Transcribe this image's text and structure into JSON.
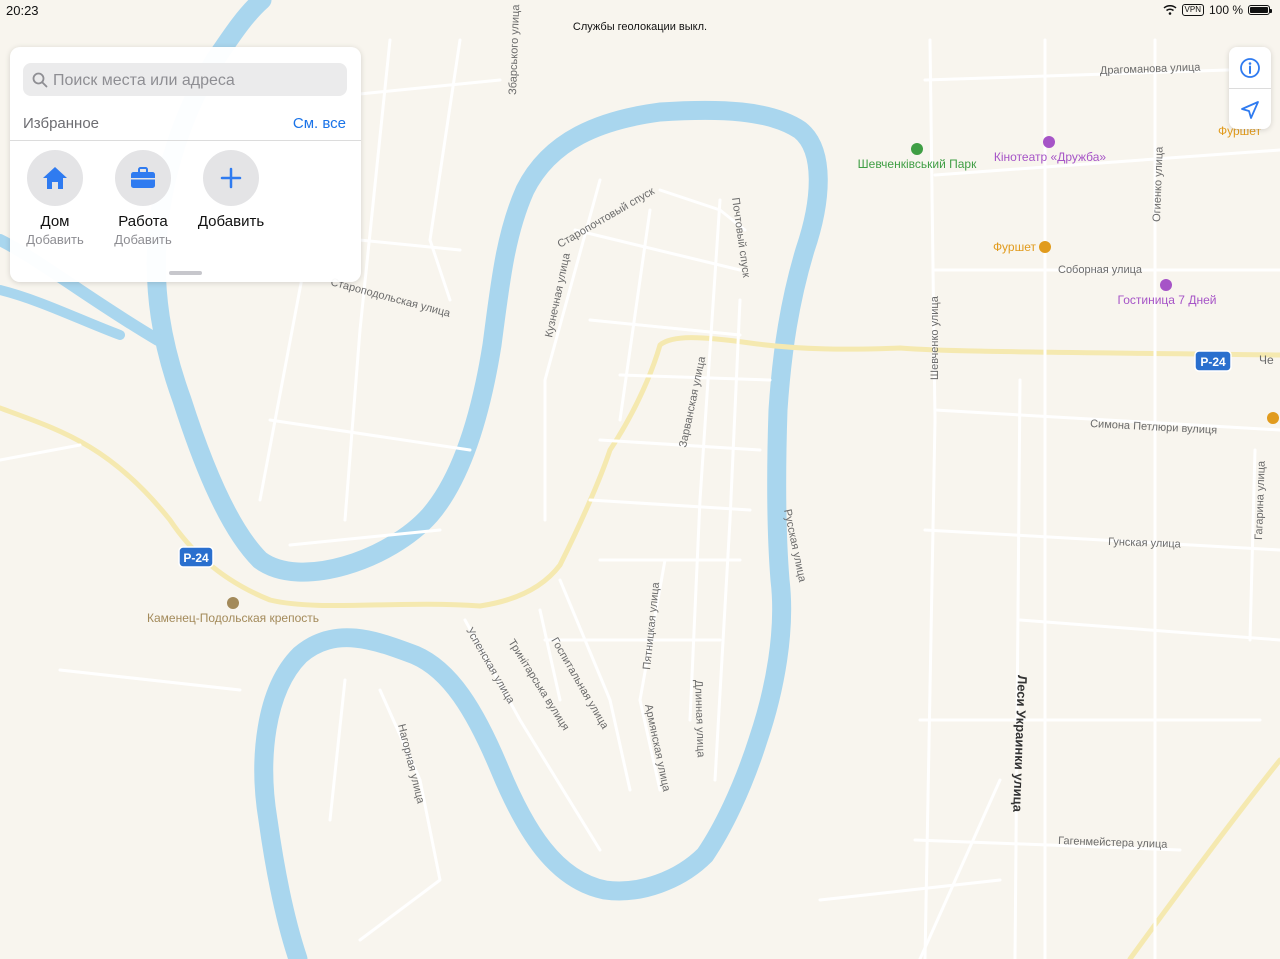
{
  "status": {
    "time": "20:23",
    "location_notice": "Службы геолокации выкл.",
    "vpn": "VPN",
    "battery": "100 %",
    "battery_level": 1.0
  },
  "search": {
    "placeholder": "Поиск места или адреса"
  },
  "favorites": {
    "title": "Избранное",
    "see_all": "См. все",
    "items": [
      {
        "name": "Дом",
        "sub": "Добавить",
        "icon": "home-icon"
      },
      {
        "name": "Работа",
        "sub": "Добавить",
        "icon": "briefcase-icon"
      },
      {
        "name": "Добавить",
        "sub": "",
        "icon": "plus-icon"
      }
    ]
  },
  "map_controls": [
    {
      "name": "info-button",
      "icon": "info-icon"
    },
    {
      "name": "locate-button",
      "icon": "location-arrow-icon"
    }
  ],
  "map": {
    "colors": {
      "land": "#f8f5ee",
      "water": "#a9d6ee",
      "road": "#ffffff",
      "road_casing": "#dcd8d0",
      "major_road": "#f5e9b0",
      "label": "#6b6b6b",
      "poi_green": "#3f9e44",
      "poi_purple": "#a654c7",
      "poi_orange": "#e19b1d",
      "shield_blue": "#2a6fce"
    },
    "street_labels": [
      "Збарського улица",
      "Драгоманова улица",
      "Староподольская улица",
      "Старопочтовый спуск",
      "Почтовый спуск",
      "Кузнечная улица",
      "Зарванская улица",
      "Огиенко улица",
      "Соборная улица",
      "Шевченко улица",
      "Симона Петлюри вулиця",
      "Гагарина улица",
      "Гунская улица",
      "Русская улица",
      "Успенская улица",
      "Тринітарська вулиця",
      "Госпитальная улица",
      "Пятницкая улица",
      "Армянская улица",
      "Длинная улица",
      "Нагорная улица",
      "Леси Украинки улица",
      "Гагенмейстера улица"
    ],
    "pois": [
      {
        "name": "Шевченківський Парк",
        "icon": "park-icon",
        "color": "#3f9e44"
      },
      {
        "name": "Кінотеатр «Дружба»",
        "icon": "cinema-icon",
        "color": "#a654c7"
      },
      {
        "name": "Фуршет",
        "icon": "shop-icon",
        "color": "#e19b1d"
      },
      {
        "name": "Гостиница 7 Дней",
        "icon": "hotel-icon",
        "color": "#a654c7"
      },
      {
        "name": "Каменец-Подольская крепость",
        "icon": "castle-icon",
        "color": "#a38a5a"
      },
      {
        "name": "Фуршет",
        "icon": "shop-icon",
        "color": "#e19b1d"
      }
    ],
    "shields": [
      "Р-24",
      "Р-24"
    ],
    "edge_labels": [
      "Че"
    ]
  }
}
